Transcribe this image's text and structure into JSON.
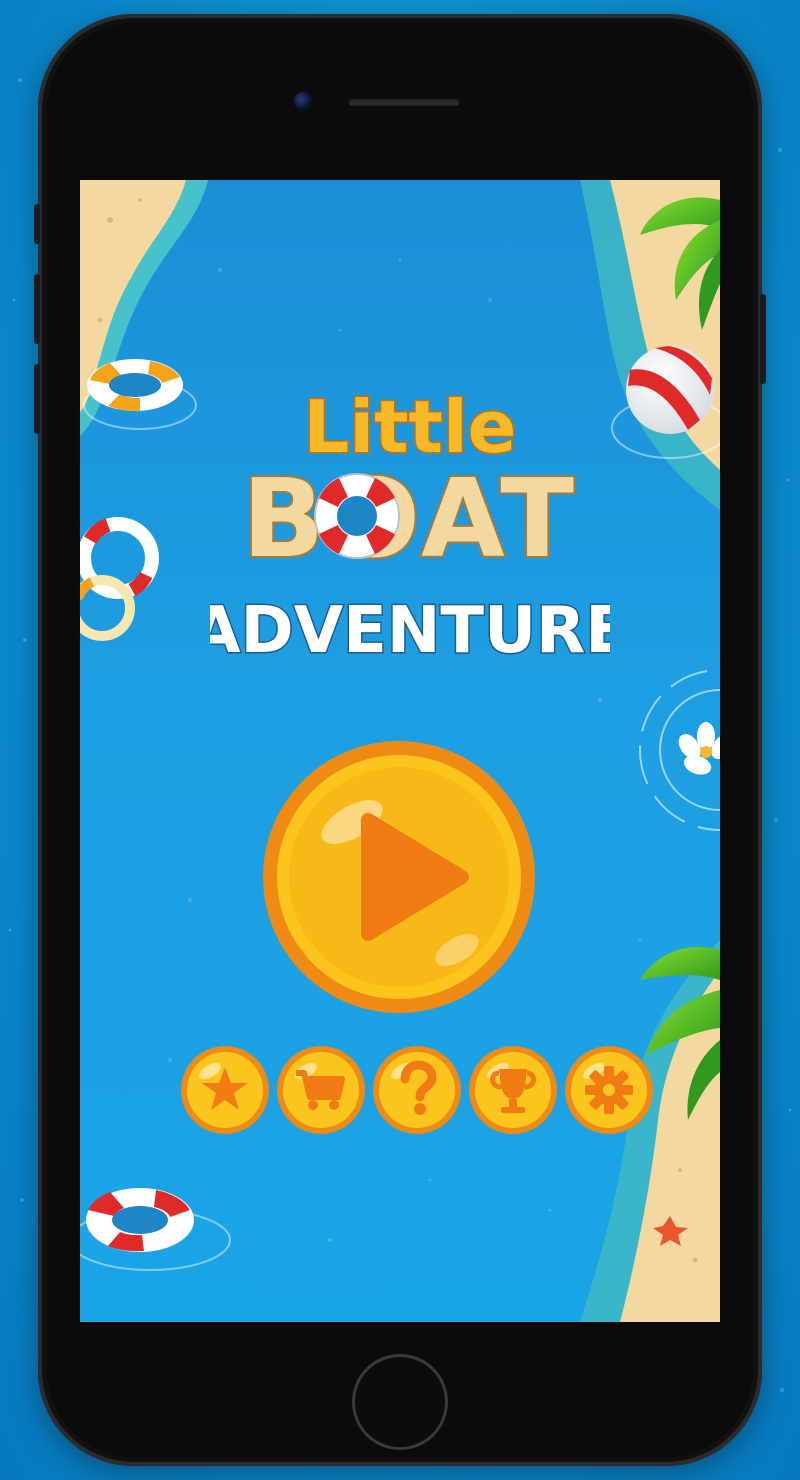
{
  "game": {
    "title_line1": "Little",
    "title_line2": "BOAT",
    "title_line3": "ADVENTURE"
  },
  "menu": {
    "play_icon": "play-icon",
    "buttons": [
      {
        "icon": "star-icon"
      },
      {
        "icon": "shopping-cart-icon"
      },
      {
        "icon": "help-question-icon"
      },
      {
        "icon": "trophy-icon"
      },
      {
        "icon": "gear-icon"
      }
    ]
  },
  "colors": {
    "water": "#1e9ee2",
    "sand": "#f3d9a0",
    "button_yellow": "#fcc51d",
    "button_orange": "#ef8a12",
    "title_gold": "#f7b928",
    "title_white": "#ffffff",
    "life_ring_red": "#e02a2a"
  }
}
